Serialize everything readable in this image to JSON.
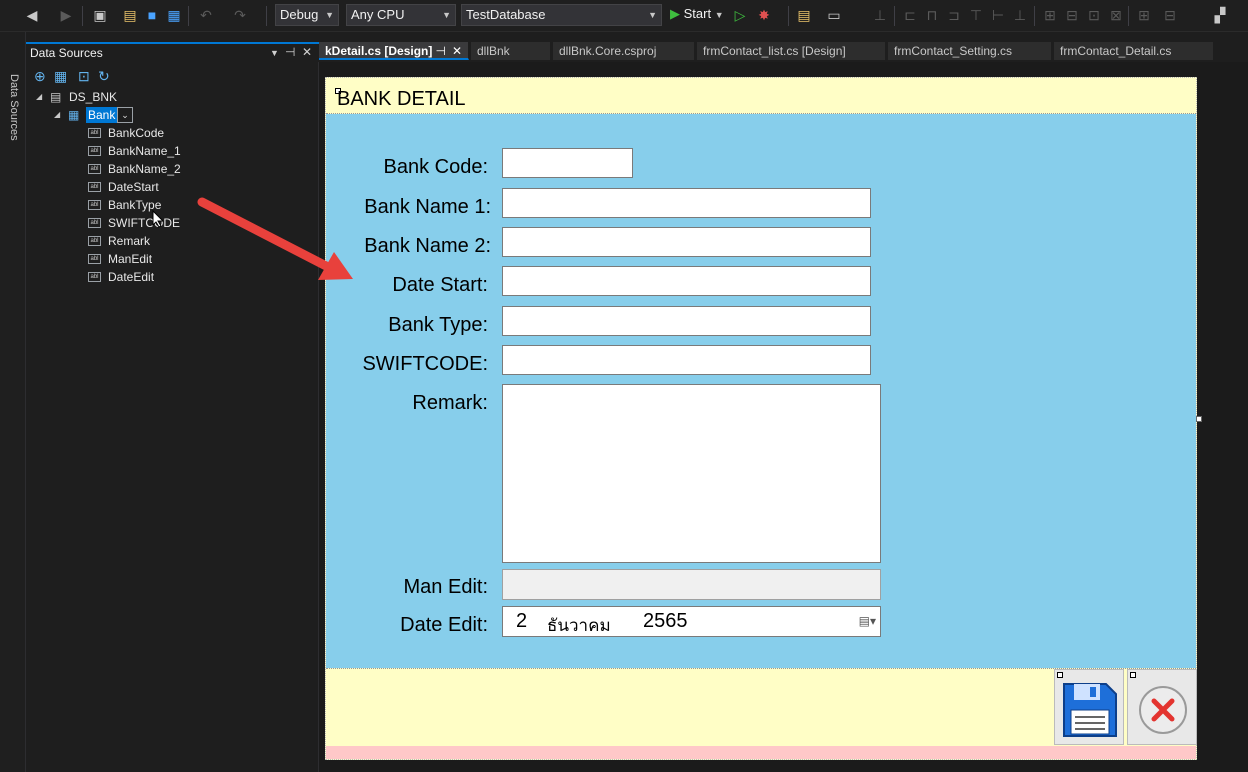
{
  "toolbar": {
    "config": "Debug",
    "platform": "Any CPU",
    "startup_project": "TestDatabase",
    "start_label": "Start"
  },
  "vertical_tab": {
    "label": "Data Sources"
  },
  "data_sources": {
    "title": "Data Sources",
    "dataset": "DS_BNK",
    "table": "Bank",
    "fields": [
      "BankCode",
      "BankName_1",
      "BankName_2",
      "DateStart",
      "BankType",
      "SWIFTCODE",
      "Remark",
      "ManEdit",
      "DateEdit"
    ],
    "field_icon_text": "abl"
  },
  "tabs": [
    {
      "label": "kDetail.cs [Design]",
      "active": true
    },
    {
      "label": "dllBnk",
      "active": false
    },
    {
      "label": "dllBnk.Core.csproj",
      "active": false
    },
    {
      "label": "frmContact_list.cs [Design]",
      "active": false
    },
    {
      "label": "frmContact_Setting.cs",
      "active": false
    },
    {
      "label": "frmContact_Detail.cs",
      "active": false
    }
  ],
  "form": {
    "title": "BANK DETAIL",
    "labels": {
      "bank_code": "Bank Code:",
      "bank_name_1": "Bank Name 1:",
      "bank_name_2": "Bank Name 2:",
      "date_start": "Date Start:",
      "bank_type": "Bank Type:",
      "swiftcode": "SWIFTCODE:",
      "remark": "Remark:",
      "man_edit": "Man Edit:",
      "date_edit": "Date Edit:"
    },
    "date_edit": {
      "day": "2",
      "month": "ธันวาคม",
      "year": "2565"
    }
  },
  "colors": {
    "form_body": "#87ceeb",
    "form_header": "#fffec6",
    "arrow": "#e8413c",
    "accent": "#0078d4"
  }
}
